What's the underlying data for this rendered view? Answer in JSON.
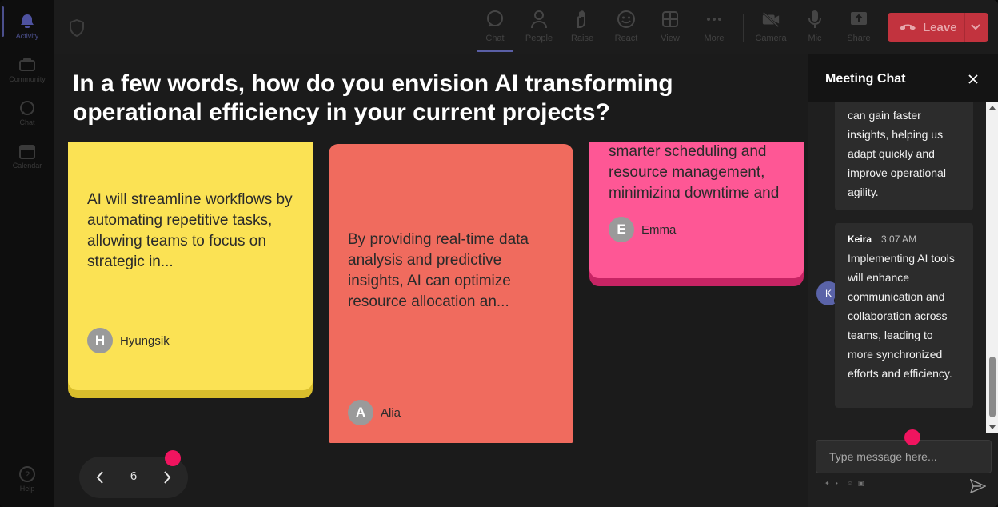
{
  "rail": {
    "items": [
      {
        "label": "Activity"
      },
      {
        "label": "Community"
      },
      {
        "label": "Chat"
      },
      {
        "label": "Calendar"
      },
      {
        "label": "Help"
      }
    ]
  },
  "toolbar": {
    "items": [
      {
        "label": "Chat",
        "icon": "chat-icon"
      },
      {
        "label": "People",
        "icon": "people-icon"
      },
      {
        "label": "Raise",
        "icon": "raise-hand-icon"
      },
      {
        "label": "React",
        "icon": "react-icon"
      },
      {
        "label": "View",
        "icon": "view-icon"
      },
      {
        "label": "More",
        "icon": "more-icon"
      },
      {
        "label": "Camera",
        "icon": "camera-off-icon"
      },
      {
        "label": "Mic",
        "icon": "mic-icon"
      },
      {
        "label": "Share",
        "icon": "share-icon"
      }
    ],
    "leave_label": "Leave"
  },
  "question": "In a few words, how do you envision AI transforming operational efficiency in your current projects?",
  "cards": [
    {
      "text": "AI will streamline workflows by automating repetitive tasks, allowing teams to focus on strategic in...",
      "author": "Hyungsik",
      "initial": "H",
      "color": "#fbe254"
    },
    {
      "text": "By providing real-time data analysis and predictive insights, AI can optimize resource allocation an...",
      "author": "Alia",
      "initial": "A",
      "color": "#f06b5e"
    },
    {
      "text": "smarter scheduling and resource management, minimizing downtime and maximizi",
      "author": "Emma",
      "initial": "E",
      "color": "#fe5795"
    }
  ],
  "pager": {
    "page": "6"
  },
  "chat": {
    "title": "Meeting Chat",
    "messages": [
      {
        "text": "can gain faster insights, helping us adapt quickly and improve operational agility."
      },
      {
        "author": "Keira",
        "initial": "K",
        "time": "3:07 AM",
        "text": "Implementing AI tools will enhance communication and collaboration across teams, leading to more synchronized efforts and efficiency."
      }
    ],
    "input_placeholder": "Type message here..."
  },
  "colors": {
    "leave": "#c2333e",
    "accent": "#5a5fa6",
    "notification_dot": "#f0145f"
  }
}
